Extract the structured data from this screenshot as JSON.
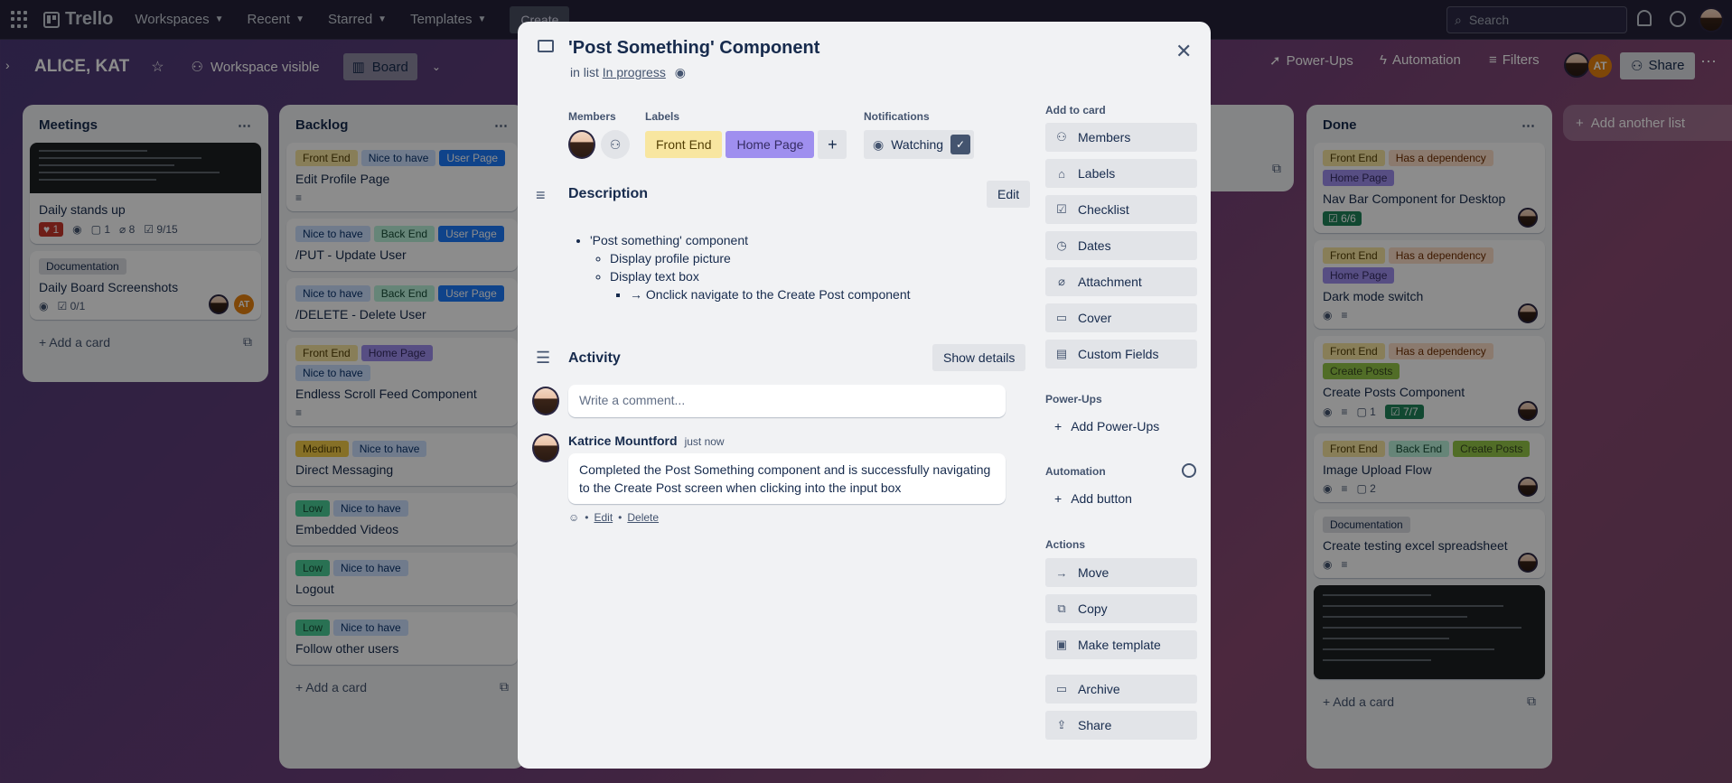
{
  "topnav": {
    "logo": "Trello",
    "workspaces": "Workspaces",
    "recent": "Recent",
    "starred": "Starred",
    "templates": "Templates",
    "create": "Create",
    "search_placeholder": "Search"
  },
  "board": {
    "title": "ALICE, KAT",
    "visibility": "Workspace visible",
    "board_view": "Board",
    "power_ups": "Power-Ups",
    "automation": "Automation",
    "filters": "Filters",
    "share": "Share",
    "add_list": "Add another list",
    "at": "AT"
  },
  "lists": {
    "meetings": {
      "title": "Meetings",
      "cards": [
        {
          "title": "Daily stands up",
          "notif": "1",
          "comments": "1",
          "attachments": "8",
          "checklist": "9/15"
        },
        {
          "label": "Documentation",
          "title": "Daily Board Screenshots",
          "checklist": "0/1"
        }
      ],
      "add": "Add a card"
    },
    "backlog": {
      "title": "Backlog",
      "cards": [
        {
          "labels": [
            "Front End",
            "Nice to have",
            "User Page"
          ],
          "title": "Edit Profile Page"
        },
        {
          "labels": [
            "Nice to have",
            "Back End",
            "User Page"
          ],
          "title": "/PUT - Update User"
        },
        {
          "labels": [
            "Nice to have",
            "Back End",
            "User Page"
          ],
          "title": "/DELETE - Delete User"
        },
        {
          "labels": [
            "Front End",
            "Home Page",
            "Nice to have"
          ],
          "title": "Endless Scroll Feed Component"
        },
        {
          "labels": [
            "Medium",
            "Nice to have"
          ],
          "title": "Direct Messaging"
        },
        {
          "labels": [
            "Low",
            "Nice to have"
          ],
          "title": "Embedded Videos"
        },
        {
          "labels": [
            "Low",
            "Nice to have"
          ],
          "title": "Logout"
        },
        {
          "labels": [
            "Low",
            "Nice to have"
          ],
          "title": "Follow other users"
        }
      ],
      "add": "Add a card"
    },
    "done": {
      "title": "Done",
      "cards": [
        {
          "labels": [
            "Front End",
            "Has a dependency",
            "Home Page"
          ],
          "title": "Nav Bar Component for Desktop",
          "checklist": "6/6"
        },
        {
          "labels": [
            "Front End",
            "Has a dependency",
            "Home Page"
          ],
          "title": "Dark mode switch"
        },
        {
          "labels": [
            "Front End",
            "Has a dependency",
            "Create Posts"
          ],
          "title": "Create Posts Component",
          "comments": "1",
          "checklist": "7/7"
        },
        {
          "labels": [
            "Front End",
            "Back End",
            "Create Posts"
          ],
          "title": "Image Upload Flow",
          "comments": "2"
        },
        {
          "labels": [
            "Documentation"
          ],
          "title": "Create testing excel spreadsheet"
        }
      ],
      "add": "Add a card"
    }
  },
  "modal": {
    "title": "'Post Something' Component",
    "in_list_prefix": "in list",
    "in_list": "In progress",
    "members_h": "Members",
    "labels_h": "Labels",
    "notifications_h": "Notifications",
    "labels": [
      "Front End",
      "Home Page"
    ],
    "watching": "Watching",
    "description_h": "Description",
    "edit": "Edit",
    "description": {
      "item": "'Post something' component",
      "sub1": "Display profile picture",
      "sub2": "Display text box",
      "subsub": "→ Onclick navigate to the Create Post component"
    },
    "activity_h": "Activity",
    "show_details": "Show details",
    "comment_placeholder": "Write a comment...",
    "comment": {
      "author": "Katrice Mountford",
      "time": "just now",
      "text": "Completed the Post Something component and is successfully navigating to the Create Post screen when clicking into the input box",
      "edit": "Edit",
      "delete": "Delete"
    },
    "sidebar": {
      "add_to_card": "Add to card",
      "members": "Members",
      "labels": "Labels",
      "checklist": "Checklist",
      "dates": "Dates",
      "attachment": "Attachment",
      "cover": "Cover",
      "custom_fields": "Custom Fields",
      "power_ups_h": "Power-Ups",
      "add_power_ups": "Add Power-Ups",
      "automation_h": "Automation",
      "add_button": "Add button",
      "actions_h": "Actions",
      "move": "Move",
      "copy": "Copy",
      "make_template": "Make template",
      "archive": "Archive",
      "share": "Share"
    }
  },
  "colors": {
    "front_end": "#f8e6a0",
    "home_page": "#9f8fef",
    "nice_to_have": "#cce0ff",
    "user_page": "#1d7afc",
    "back_end": "#baf3db",
    "low": "#4bce97",
    "medium": "#f5cd47"
  }
}
